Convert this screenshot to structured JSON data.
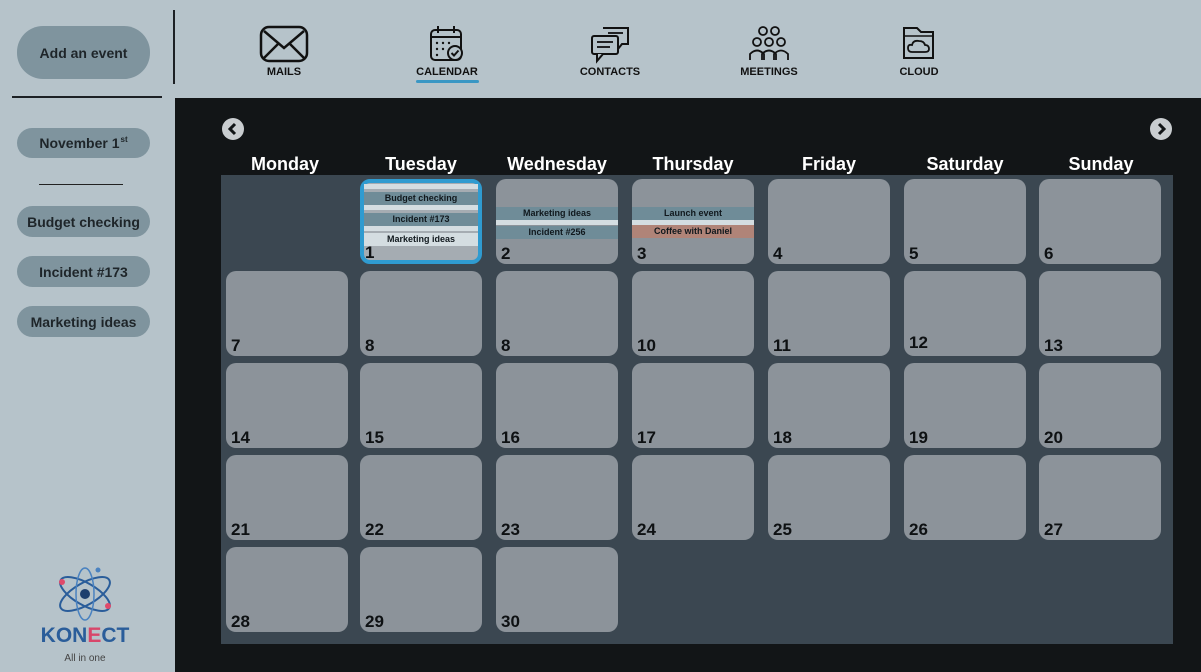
{
  "sidebar": {
    "add_event_label": "Add an event",
    "date_label": "November 1",
    "date_suffix": "st",
    "events": [
      "Budget checking",
      "Incident #173",
      "Marketing ideas"
    ],
    "logo": {
      "brand": "KONECT",
      "tagline": "All in one"
    }
  },
  "nav": {
    "items": [
      {
        "label": "MAILS",
        "icon": "mail-icon"
      },
      {
        "label": "CALENDAR",
        "icon": "calendar-icon",
        "active": true
      },
      {
        "label": "CONTACTS",
        "icon": "chat-icon"
      },
      {
        "label": "MEETINGS",
        "icon": "people-icon"
      },
      {
        "label": "CLOUD",
        "icon": "cloud-folder-icon"
      }
    ]
  },
  "calendar": {
    "prev_icon": "chevron-left-icon",
    "next_icon": "chevron-right-icon",
    "weekdays": [
      "Monday",
      "Tuesday",
      "Wednesday",
      "Thursday",
      "Friday",
      "Saturday",
      "Sunday"
    ],
    "days": [
      "1",
      "2",
      "3",
      "4",
      "5",
      "6",
      "7",
      "8",
      "8",
      "10",
      "11",
      "12",
      "13",
      "14",
      "15",
      "16",
      "17",
      "18",
      "19",
      "20",
      "21",
      "22",
      "23",
      "24",
      "25",
      "26",
      "27",
      "28",
      "29",
      "30"
    ],
    "events": {
      "day1": [
        "Budget checking",
        "Incident #173",
        "Marketing ideas"
      ],
      "day2": [
        "Marketing ideas",
        "Incident #256"
      ],
      "day3": [
        "Launch event",
        "Coffee with Daniel"
      ]
    }
  },
  "colors": {
    "accent": "#3a97c4",
    "event_bg": "#6f8c98",
    "highlight_event": "#b08478"
  }
}
